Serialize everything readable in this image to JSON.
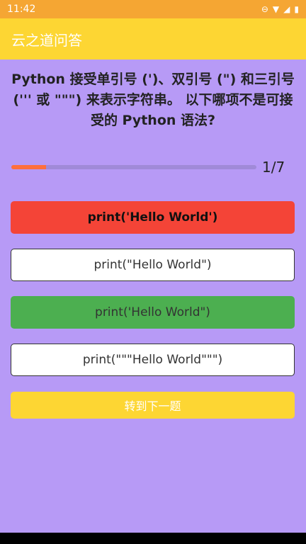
{
  "status_bar": {
    "time": "11:42",
    "icons": [
      "dnd-icon",
      "wifi-icon",
      "signal-icon",
      "battery-icon"
    ]
  },
  "app_bar": {
    "title": "云之道问答"
  },
  "question": {
    "text": "Python 接受单引号 (')、双引号 (\") 和三引号 (''' 或 \"\"\") 来表示字符串。 以下哪项不是可接受的 Python 语法?"
  },
  "progress": {
    "current": 1,
    "total": 7,
    "label": "1/7",
    "fraction": 0.143
  },
  "options": [
    {
      "label": "print('Hello World')",
      "state": "wrong-selected"
    },
    {
      "label": "print(\"Hello World\")",
      "state": "normal"
    },
    {
      "label": "print('Hello World\")",
      "state": "correct"
    },
    {
      "label": "print(\"\"\"Hello World\"\"\")",
      "state": "normal"
    }
  ],
  "next_button": {
    "label": "转到下一题"
  },
  "colors": {
    "status": "#f5a633",
    "app_bar": "#fdd633",
    "background": "#b79af6",
    "wrong": "#f44437",
    "correct": "#4caf50",
    "progress": "#ff6f3d"
  }
}
